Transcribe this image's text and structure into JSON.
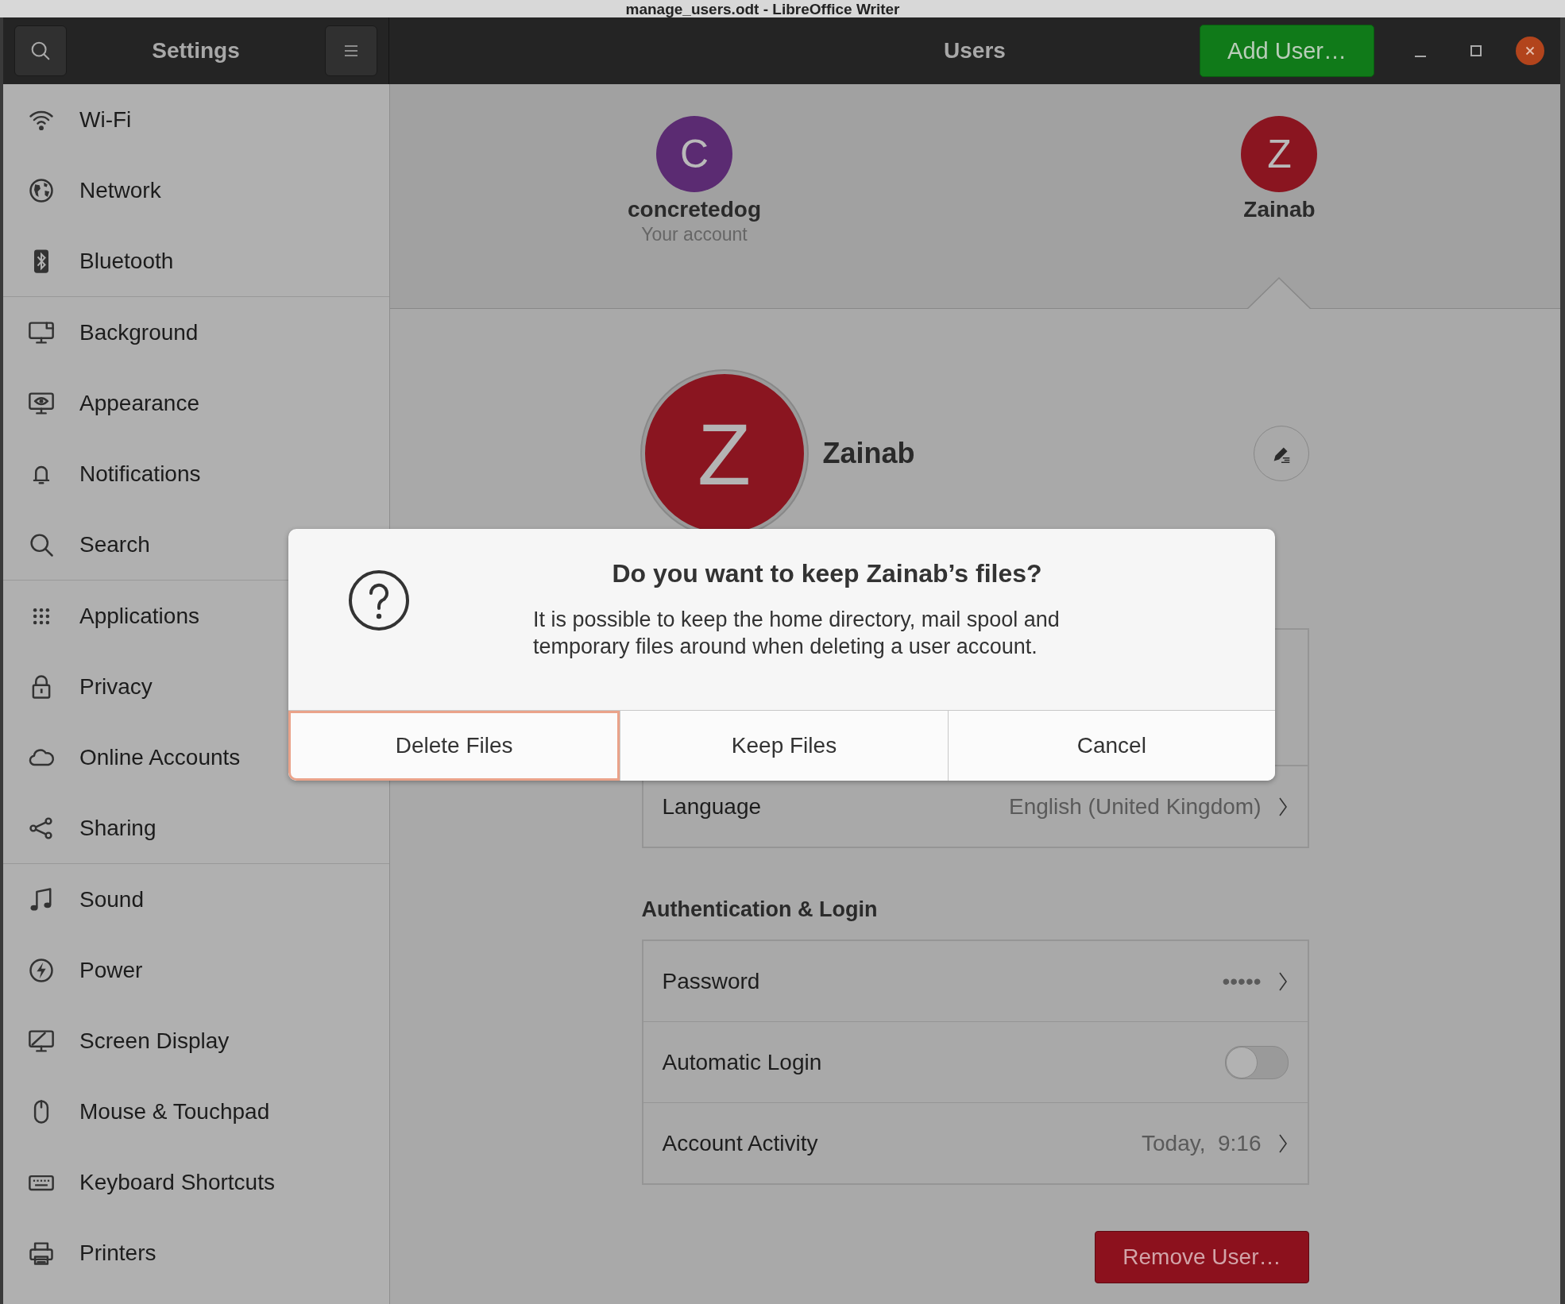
{
  "background_window": {
    "title": "manage_users.odt - LibreOffice Writer"
  },
  "header": {
    "title": "Settings",
    "page_title": "Users",
    "add_button": "Add User…"
  },
  "sidebar": {
    "groups": [
      [
        {
          "label": "Wi-Fi",
          "selected": false
        },
        {
          "label": "Network",
          "selected": false
        },
        {
          "label": "Bluetooth",
          "selected": false
        }
      ],
      [
        {
          "label": "Background",
          "selected": false
        },
        {
          "label": "Appearance",
          "selected": false
        },
        {
          "label": "Notifications",
          "selected": false
        },
        {
          "label": "Search",
          "selected": false
        }
      ],
      [
        {
          "label": "Applications",
          "selected": false
        },
        {
          "label": "Privacy",
          "selected": false
        },
        {
          "label": "Online Accounts",
          "selected": false
        },
        {
          "label": "Sharing",
          "selected": false
        }
      ],
      [
        {
          "label": "Sound",
          "selected": false
        },
        {
          "label": "Power",
          "selected": false
        },
        {
          "label": "Screen Display",
          "selected": false
        },
        {
          "label": "Mouse & Touchpad",
          "selected": false
        },
        {
          "label": "Keyboard Shortcuts",
          "selected": false
        },
        {
          "label": "Printers",
          "selected": false
        }
      ]
    ]
  },
  "users": [
    {
      "initial": "C",
      "name": "concretedog",
      "subtitle": "Your account",
      "color": "#5b2b72",
      "selected": false
    },
    {
      "initial": "Z",
      "name": "Zainab",
      "color": "#8a1520",
      "selected": true
    }
  ],
  "account": {
    "initial": "Z",
    "name": "Zainab"
  },
  "details": [
    {
      "label": "Language",
      "value": "English (United Kingdom)"
    }
  ],
  "auth": {
    "heading": "Authentication & Login",
    "rows": [
      {
        "kind": "link",
        "label": "Password",
        "value": "•••••"
      },
      {
        "kind": "switch",
        "label": "Automatic Login",
        "on": false
      },
      {
        "kind": "link",
        "label": "Account Activity",
        "value": "Today,  9:16"
      }
    ]
  },
  "remove_button": "Remove User…",
  "dialog": {
    "title": "Do you want to keep Zainab’s files?",
    "message": "It is possible to keep the home directory, mail spool and temporary files around when deleting a user account.",
    "buttons": [
      {
        "label": "Delete Files",
        "focused": true
      },
      {
        "label": "Keep Files",
        "focused": false
      },
      {
        "label": "Cancel",
        "focused": false
      }
    ]
  }
}
